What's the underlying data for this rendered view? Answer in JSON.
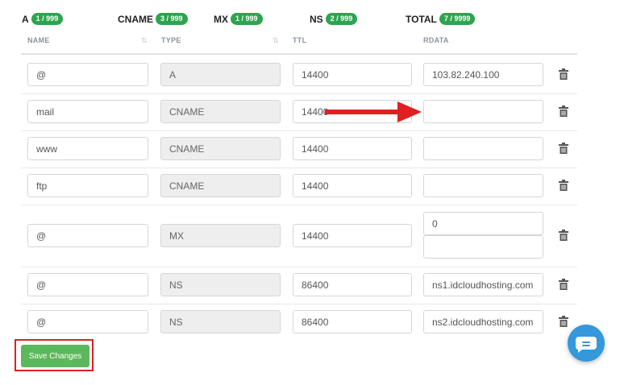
{
  "counters": [
    {
      "label": "A",
      "count": "1 / 999"
    },
    {
      "label": "CNAME",
      "count": "3 / 999"
    },
    {
      "label": "MX",
      "count": "1 / 999"
    },
    {
      "label": "NS",
      "count": "2 / 999"
    },
    {
      "label": "TOTAL",
      "count": "7 / 9999"
    }
  ],
  "columns": {
    "name": "NAME",
    "type": "TYPE",
    "ttl": "TTL",
    "rdata": "RDATA"
  },
  "records": [
    {
      "name": "@",
      "type": "A",
      "ttl": "14400",
      "rdata": "103.82.240.100"
    },
    {
      "name": "mail",
      "type": "CNAME",
      "ttl": "14400",
      "rdata": ""
    },
    {
      "name": "www",
      "type": "CNAME",
      "ttl": "14400",
      "rdata": ""
    },
    {
      "name": "ftp",
      "type": "CNAME",
      "ttl": "14400",
      "rdata": ""
    },
    {
      "name": "@",
      "type": "MX",
      "ttl": "14400",
      "rdata_priority": "0",
      "rdata": ""
    },
    {
      "name": "@",
      "type": "NS",
      "ttl": "86400",
      "rdata": "ns1.idcloudhosting.com"
    },
    {
      "name": "@",
      "type": "NS",
      "ttl": "86400",
      "rdata": "ns2.idcloudhosting.com"
    }
  ],
  "save_button": {
    "label": "Save Changes"
  },
  "colors": {
    "badge": "#2ea44f",
    "save": "#5cb85c",
    "chat": "#3498db",
    "highlight": "#e02020"
  },
  "icons": {
    "delete": "trash-icon",
    "chat": "chat-icon",
    "annotation": "arrow-icon"
  }
}
